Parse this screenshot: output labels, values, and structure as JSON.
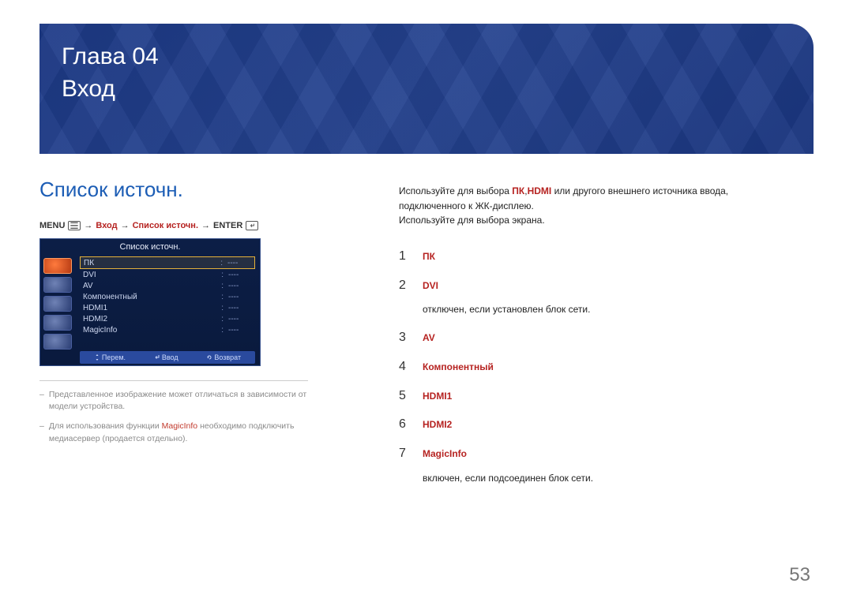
{
  "chapter": {
    "line1": "Глава 04",
    "line2": "Вход"
  },
  "section_title": "Список источн.",
  "breadcrumb": {
    "menu": "MENU",
    "arrow": "→",
    "step1": "Вход",
    "step2": "Список источн.",
    "enter": "ENTER"
  },
  "osd": {
    "title": "Список источн.",
    "items": [
      {
        "label": "ПК",
        "val": "----",
        "selected": true
      },
      {
        "label": "DVI",
        "val": "----"
      },
      {
        "label": "AV",
        "val": "----"
      },
      {
        "label": "Компонентный",
        "val": "----"
      },
      {
        "label": "HDMI1",
        "val": "----"
      },
      {
        "label": "HDMI2",
        "val": "----"
      },
      {
        "label": "MagicInfo",
        "val": "----"
      }
    ],
    "footer": {
      "move": "Перем.",
      "enter": "Ввод",
      "back": "Возврат"
    }
  },
  "footnotes": {
    "n1": "Представленное изображение может отличаться в зависимости от модели устройства.",
    "n2_a": "Для использования функции ",
    "n2_hl": "MagicInfo",
    "n2_b": " необходимо подключить медиасервер (продается отдельно)."
  },
  "intro": {
    "p1_a": "Используйте для выбора ",
    "p1_hl1": "ПК",
    "p1_mid": ",",
    "p1_hl2": "HDMI",
    "p1_b": " или другого внешнего источника ввода, подключенного к ЖК-дисплею.",
    "p2": "Используйте для выбора экрана."
  },
  "list": [
    {
      "n": "1",
      "label": "ПК"
    },
    {
      "n": "2",
      "label": "DVI",
      "note": "отключен, если установлен блок сети."
    },
    {
      "n": "3",
      "label": "AV"
    },
    {
      "n": "4",
      "label": "Компонентный"
    },
    {
      "n": "5",
      "label": "HDMI1"
    },
    {
      "n": "6",
      "label": "HDMI2"
    },
    {
      "n": "7",
      "label": "MagicInfo",
      "note": "включен, если подсоединен блок сети."
    }
  ],
  "page_number": "53"
}
